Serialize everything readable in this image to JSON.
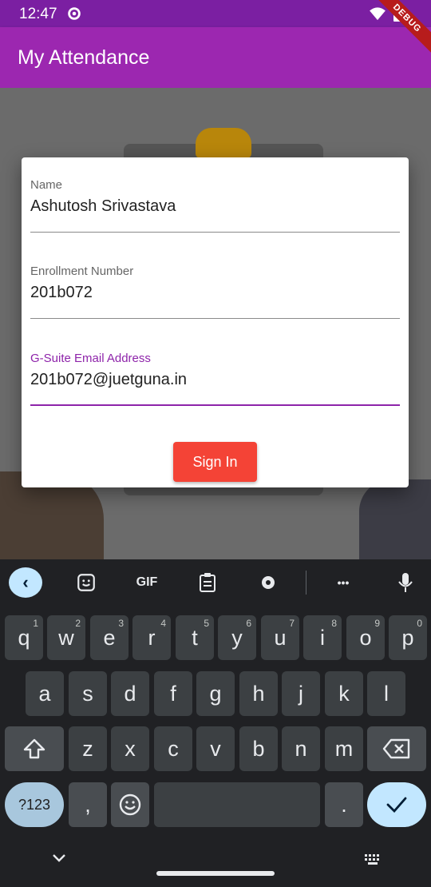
{
  "status": {
    "time": "12:47"
  },
  "app": {
    "title": "My Attendance",
    "debug_banner": "DEBUG"
  },
  "form": {
    "fields": [
      {
        "label": "Name",
        "value": "Ashutosh Srivastava"
      },
      {
        "label": "Enrollment Number",
        "value": "201b072"
      },
      {
        "label": "G-Suite Email Address",
        "value": "201b072@juetguna.in"
      }
    ],
    "sign_in_label": "Sign In"
  },
  "keyboard": {
    "toolbar": {
      "gif_label": "GIF",
      "more_label": "•••"
    },
    "row1": [
      {
        "key": "q",
        "hint": "1"
      },
      {
        "key": "w",
        "hint": "2"
      },
      {
        "key": "e",
        "hint": "3"
      },
      {
        "key": "r",
        "hint": "4"
      },
      {
        "key": "t",
        "hint": "5"
      },
      {
        "key": "y",
        "hint": "6"
      },
      {
        "key": "u",
        "hint": "7"
      },
      {
        "key": "i",
        "hint": "8"
      },
      {
        "key": "o",
        "hint": "9"
      },
      {
        "key": "p",
        "hint": "0"
      }
    ],
    "row2": [
      "a",
      "s",
      "d",
      "f",
      "g",
      "h",
      "j",
      "k",
      "l"
    ],
    "row3": [
      "z",
      "x",
      "c",
      "v",
      "b",
      "n",
      "m"
    ],
    "row4": {
      "symbols": "?123",
      "comma": ",",
      "period": "."
    }
  },
  "colors": {
    "status_bar": "#7b1fa2",
    "app_bar": "#9c27b0",
    "accent": "#8e24aa",
    "button": "#f44336",
    "keyboard_bg": "#202124",
    "key_bg": "#3c4043"
  },
  "icons": [
    "gear-icon",
    "wifi-icon",
    "battery-icon",
    "chevron-left-icon",
    "sticker-icon",
    "clipboard-icon",
    "settings-icon",
    "more-icon",
    "mic-icon",
    "shift-icon",
    "backspace-icon",
    "emoji-icon",
    "check-icon",
    "chevron-down-icon",
    "keyboard-icon"
  ]
}
